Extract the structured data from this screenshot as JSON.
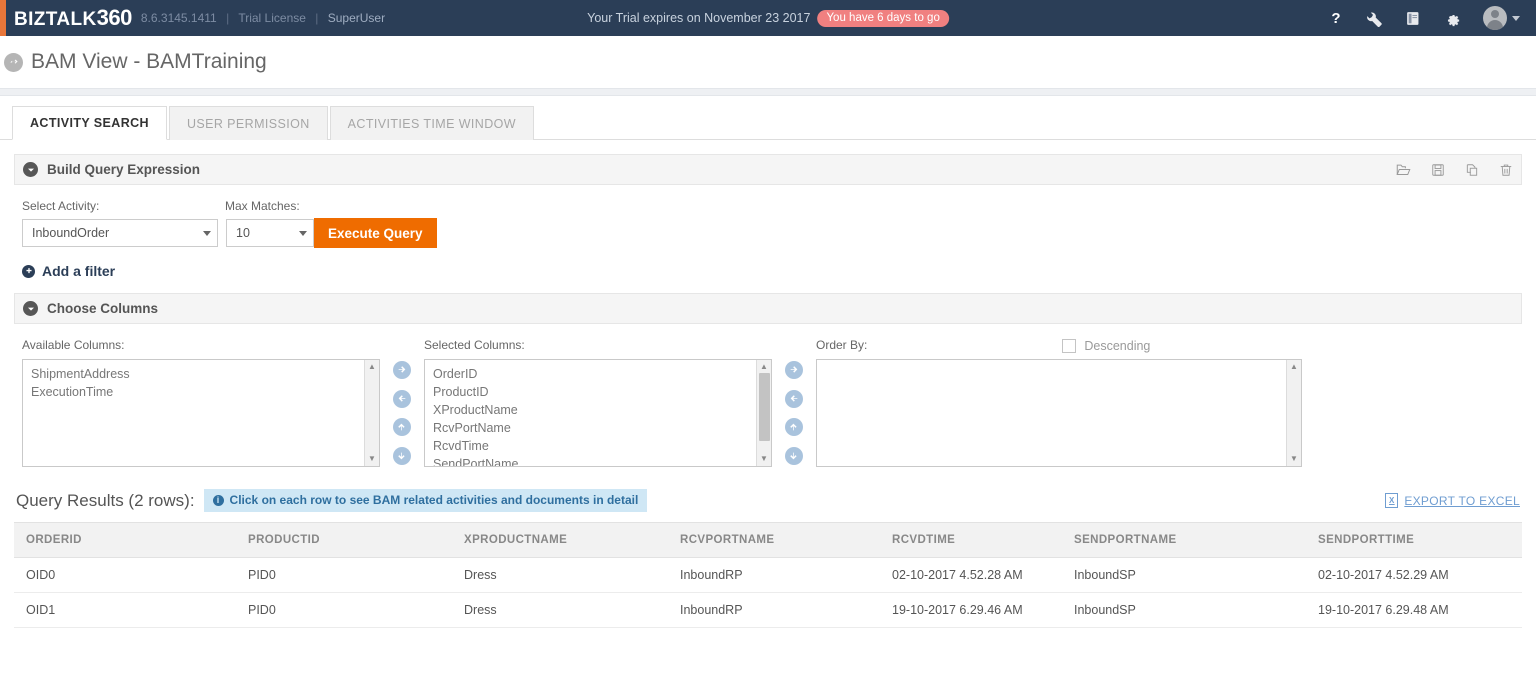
{
  "topnav": {
    "brand_text": "BIZTALK",
    "brand_num": "360",
    "version": "8.6.3145.1411",
    "license": "Trial License",
    "user": "SuperUser",
    "trial_text": "Your Trial expires on November 23 2017",
    "trial_badge": "You have 6 days to go",
    "icons": [
      "help-icon",
      "wrench-icon",
      "book-icon",
      "gear-icon",
      "avatar"
    ],
    "bg_color": "#2b3e57",
    "accent_color": "#e8763a",
    "badge_color": "#f08080"
  },
  "page": {
    "title": "BAM View - BAMTraining"
  },
  "tabs": [
    {
      "label": "ACTIVITY SEARCH",
      "active": true
    },
    {
      "label": "USER PERMISSION",
      "active": false
    },
    {
      "label": "ACTIVITIES TIME WINDOW",
      "active": false
    }
  ],
  "build_query": {
    "panel_title": "Build Query Expression",
    "tools": [
      "open-folder-icon",
      "save-icon",
      "copy-icon",
      "trash-icon"
    ],
    "activity_label": "Select Activity:",
    "activity_value": "InboundOrder",
    "max_matches_label": "Max Matches:",
    "max_matches_value": "10",
    "execute_label": "Execute Query",
    "execute_color": "#ef6c00",
    "add_filter_label": "Add a filter"
  },
  "choose_columns": {
    "panel_title": "Choose Columns",
    "available_label": "Available Columns:",
    "available": [
      "ShipmentAddress",
      "ExecutionTime"
    ],
    "selected_label": "Selected Columns:",
    "selected": [
      "OrderID",
      "ProductID",
      "XProductName",
      "RcvPortName",
      "RcvdTime",
      "SendPortName"
    ],
    "order_by_label": "Order By:",
    "order_by": [],
    "descending_label": "Descending",
    "descending_checked": false,
    "transfer_buttons": [
      "move-right",
      "move-left",
      "move-up",
      "move-down"
    ]
  },
  "results": {
    "title": "Query Results (2 rows):",
    "info_text": "Click on each row to see BAM related activities and documents in detail",
    "export_label": "EXPORT TO EXCEL",
    "columns": [
      "ORDERID",
      "PRODUCTID",
      "XPRODUCTNAME",
      "RCVPORTNAME",
      "RCVDTIME",
      "SENDPORTNAME",
      "SENDPORTTIME"
    ],
    "rows": [
      [
        "OID0",
        "PID0",
        "Dress",
        "InboundRP",
        "02-10-2017 4.52.28 AM",
        "InboundSP",
        "02-10-2017 4.52.29 AM"
      ],
      [
        "OID1",
        "PID0",
        "Dress",
        "InboundRP",
        "19-10-2017 6.29.46 AM",
        "InboundSP",
        "19-10-2017 6.29.48 AM"
      ]
    ]
  }
}
